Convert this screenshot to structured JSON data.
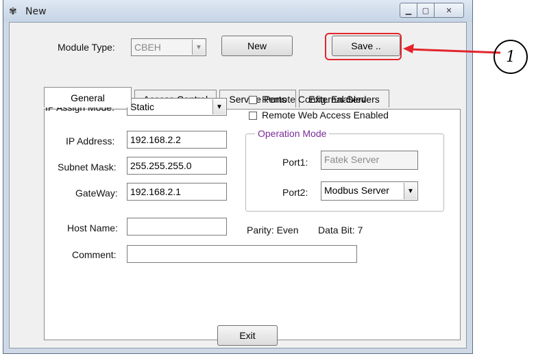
{
  "window": {
    "title": "New"
  },
  "module": {
    "label": "Module Type:",
    "value": "CBEH"
  },
  "buttons": {
    "new": "New",
    "save": "Save ..",
    "exit": "Exit"
  },
  "tabs": [
    "General",
    "Access Control",
    "Service Ports",
    "External Servers"
  ],
  "general": {
    "ip_assign_label": "IP Assign Mode:",
    "ip_assign_value": "Static",
    "ip_label": "IP Address:",
    "ip_value": "192.168.2.2",
    "subnet_label": "Subnet Mask:",
    "subnet_value": "255.255.255.0",
    "gateway_label": "GateWay:",
    "gateway_value": "192.168.2.1",
    "host_label": "Host Name:",
    "host_value": "",
    "comment_label": "Comment:",
    "comment_value": ""
  },
  "options": {
    "remote_config": "Remote Config. Enabled",
    "remote_web": "Remote Web Access Enabled"
  },
  "operation": {
    "title": "Operation Mode",
    "port1_label": "Port1:",
    "port1_value": "Fatek Server",
    "port2_label": "Port2:",
    "port2_value": "Modbus Server"
  },
  "status": {
    "parity": "Parity: Even",
    "databit": "Data Bit: 7"
  },
  "annotation": {
    "number": "1",
    "color": "#e3242b"
  }
}
